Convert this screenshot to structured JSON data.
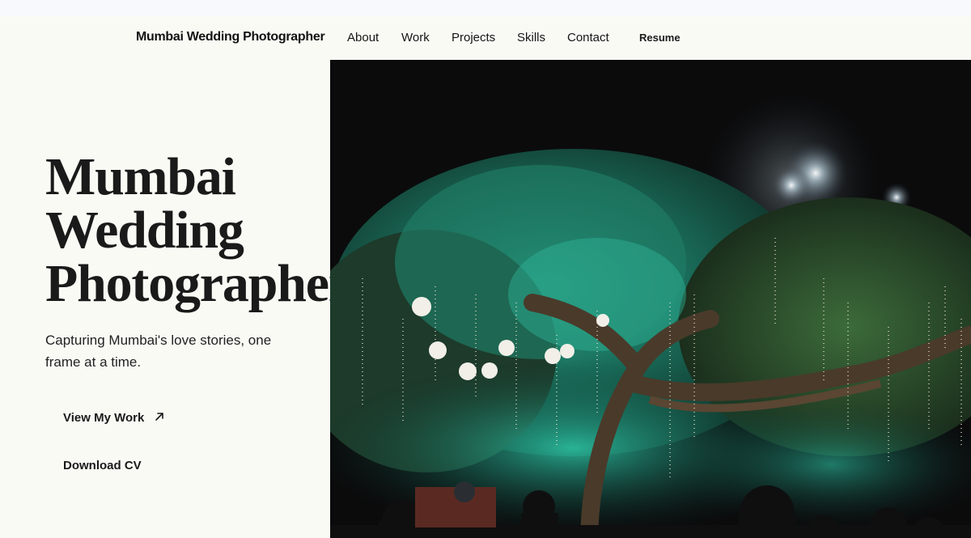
{
  "header": {
    "brand": "Mumbai Wedding Photographer",
    "nav": {
      "about": "About",
      "work": "Work",
      "projects": "Projects",
      "skills": "Skills",
      "contact": "Contact",
      "resume": "Resume"
    }
  },
  "hero": {
    "title_line1": "Mumbai",
    "title_line2": "Wedding",
    "title_line3": "Photographer",
    "subtitle": "Capturing Mumbai's love stories, one frame at a time.",
    "view_work": "View My Work",
    "download_cv": "Download CV",
    "image_subject": "illuminated tree with hanging lanterns and string lights at night"
  },
  "colors": {
    "background": "#fafaf5",
    "text": "#1a1a1a",
    "image_sky": "#0b0b0c",
    "foliage_teal": "#1f8f7a"
  },
  "icons": {
    "cta_arrow": "arrow-up-right-icon"
  }
}
